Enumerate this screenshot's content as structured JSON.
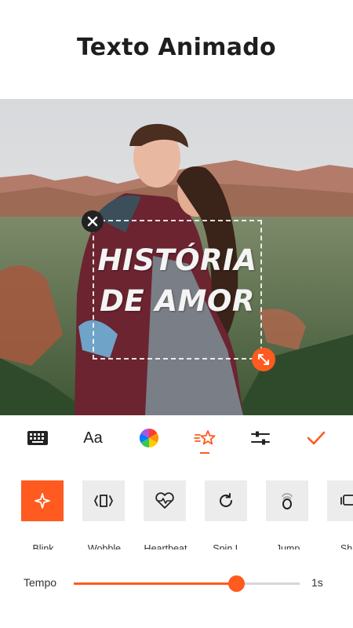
{
  "header": {
    "title": "Texto Animado"
  },
  "overlay": {
    "line1": "HISTÓRIA",
    "line2": "DE AMOR"
  },
  "toolbar": {
    "icons": [
      "keyboard-icon",
      "font-icon",
      "color-wheel-icon",
      "animation-icon",
      "adjust-icon",
      "check-icon"
    ],
    "font_label": "Aa",
    "active": "animation",
    "accent_color": "#ff5a1f"
  },
  "effects": [
    {
      "label": "Blink",
      "icon": "blink-icon",
      "active": true
    },
    {
      "label": "Wobble",
      "icon": "wobble-icon",
      "active": false
    },
    {
      "label": "Heartbeat",
      "icon": "heartbeat-icon",
      "active": false
    },
    {
      "label": "Spin L",
      "icon": "spin-left-icon",
      "active": false
    },
    {
      "label": "Jump",
      "icon": "jump-icon",
      "active": false
    },
    {
      "label": "Sha",
      "icon": "shake-icon",
      "active": false
    }
  ],
  "tempo": {
    "label": "Tempo",
    "value_label": "1s",
    "fraction": 0.72
  }
}
